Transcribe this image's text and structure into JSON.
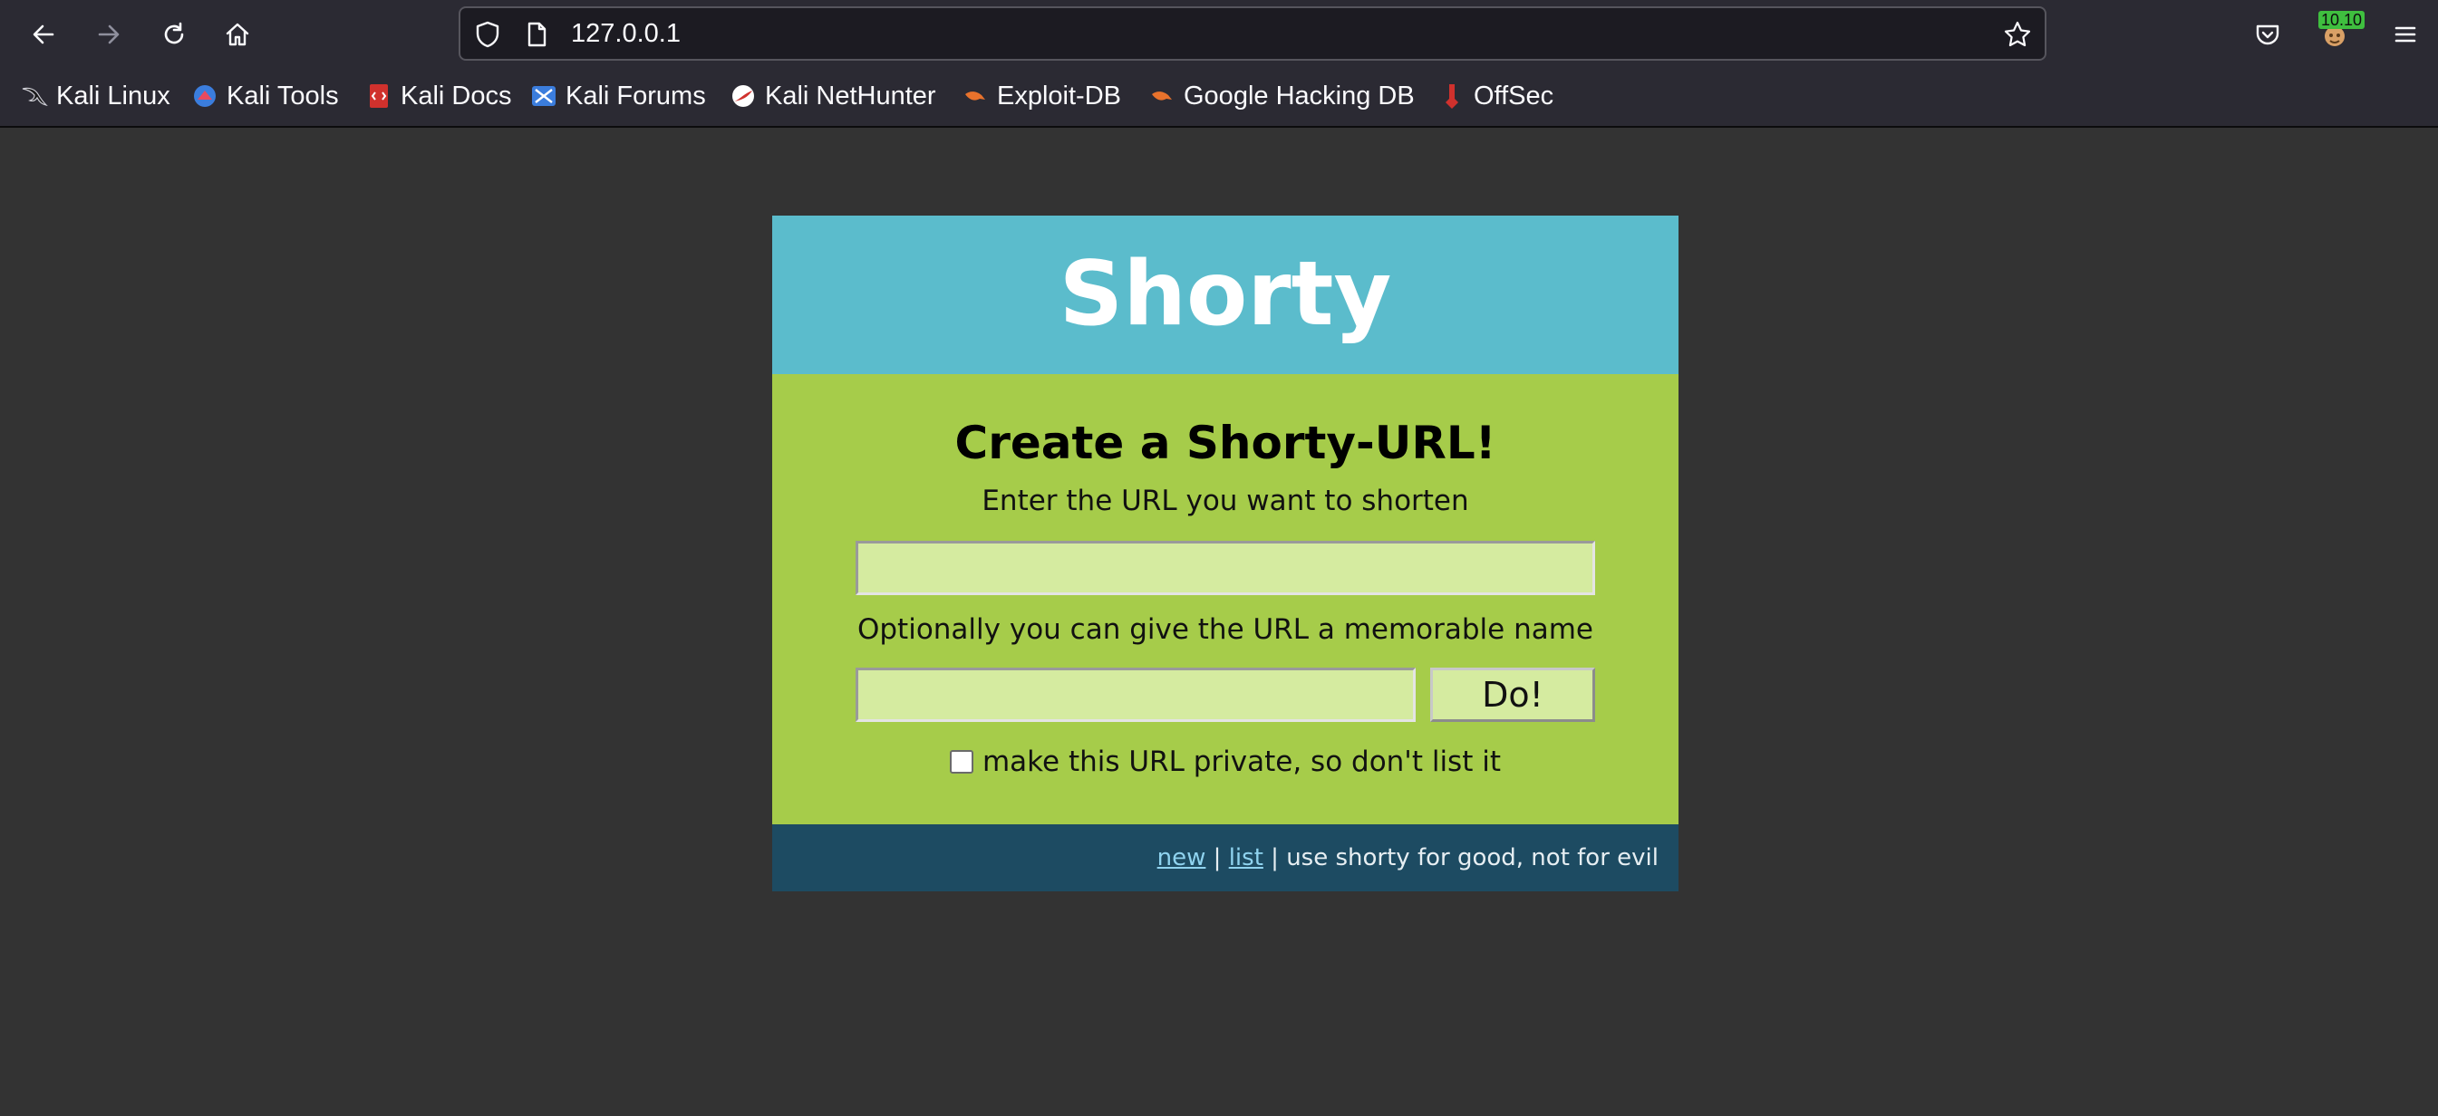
{
  "browser": {
    "url": "127.0.0.1",
    "extension_badge": "10.10",
    "bookmarks": [
      {
        "label": "Kali Linux",
        "icon": "kali-dragon-icon"
      },
      {
        "label": "Kali Tools",
        "icon": "kali-tools-icon"
      },
      {
        "label": "Kali Docs",
        "icon": "kali-docs-icon"
      },
      {
        "label": "Kali Forums",
        "icon": "kali-forums-icon"
      },
      {
        "label": "Kali NetHunter",
        "icon": "kali-nethunter-icon"
      },
      {
        "label": "Exploit-DB",
        "icon": "exploit-db-icon"
      },
      {
        "label": "Google Hacking DB",
        "icon": "ghdb-icon"
      },
      {
        "label": "OffSec",
        "icon": "offsec-icon"
      }
    ]
  },
  "page": {
    "title": "Shorty",
    "heading": "Create a Shorty-URL!",
    "url_label": "Enter the URL you want to shorten",
    "url_value": "",
    "name_label": "Optionally you can give the URL a memorable name",
    "name_value": "",
    "submit_label": "Do!",
    "private_label": "make this URL private, so don't list it",
    "private_checked": false,
    "footer": {
      "new_link": "new",
      "separator1": " | ",
      "list_link": "list",
      "separator2": " | ",
      "tagline": "use shorty for good, not for evil"
    }
  },
  "colors": {
    "header_bg": "#5bbccc",
    "body_bg": "#a6cc4a",
    "footer_bg": "#1d4b62",
    "field_bg": "#d5eba0",
    "page_bg": "#333333"
  }
}
